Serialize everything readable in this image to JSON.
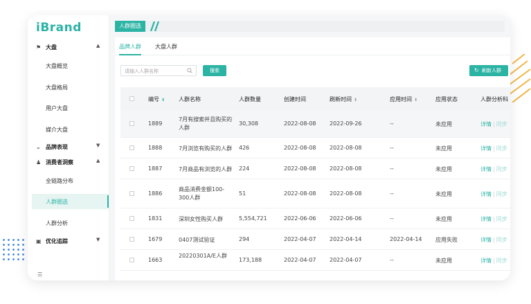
{
  "brand": {
    "logo": "iBrand",
    "accent": "#2bb3a4"
  },
  "sidebar": {
    "groups": [
      {
        "label": "大盘",
        "icon": "flag-icon",
        "caret": "▲"
      },
      {
        "label": "品牌表现",
        "icon": "chevron-icon",
        "caret": "▼"
      },
      {
        "label": "消费者洞察",
        "icon": "user-icon",
        "caret": "▲"
      },
      {
        "label": "优化追踪",
        "icon": "calendar-icon",
        "caret": "▼"
      }
    ],
    "items": [
      {
        "label": "大盘概览"
      },
      {
        "label": "大盘格局"
      },
      {
        "label": "用户大盘"
      },
      {
        "label": "媒介大盘"
      },
      {
        "label": "全链路分布"
      },
      {
        "label": "人群圈选"
      },
      {
        "label": "人群分析"
      }
    ],
    "active_item": "人群圈选"
  },
  "breadcrumb": {
    "current": "人群圈选"
  },
  "tabs": [
    {
      "label": "品牌人群"
    },
    {
      "label": "大盘人群"
    }
  ],
  "toolbar": {
    "search_placeholder": "请输入人群名称",
    "search_button": "搜索",
    "refresh_button": "刷新人群"
  },
  "table": {
    "columns": [
      "编号",
      "人群名称",
      "人群数量",
      "创建时间",
      "刷新时间",
      "应用时间",
      "应用状态",
      "人群分析科"
    ],
    "rows": [
      {
        "id": "1889",
        "name": "7月有搜索并且购买的人群",
        "count": "30,308",
        "created": "2022-08-08",
        "refreshed": "2022-09-26",
        "applied": "--",
        "status": "未应用"
      },
      {
        "id": "1888",
        "name": "7月浏览有购买的人群",
        "count": "426",
        "created": "2022-08-08",
        "refreshed": "2022-08-08",
        "applied": "--",
        "status": "未应用"
      },
      {
        "id": "1887",
        "name": "7月商品有浏览的人群",
        "count": "224",
        "created": "2022-08-08",
        "refreshed": "2022-08-08",
        "applied": "--",
        "status": "未应用"
      },
      {
        "id": "1886",
        "name": "商品消费金额100-300人群",
        "count": "51",
        "created": "2022-08-08",
        "refreshed": "2022-08-08",
        "applied": "--",
        "status": "未应用"
      },
      {
        "id": "1831",
        "name": "深圳女性购买人群",
        "count": "5,554,721",
        "created": "2022-06-06",
        "refreshed": "2022-06-06",
        "applied": "--",
        "status": "未应用"
      },
      {
        "id": "1679",
        "name": "0407测试验证",
        "count": "294",
        "created": "2022-04-07",
        "refreshed": "2022-04-14",
        "applied": "2022-04-14",
        "status": "应用失败"
      },
      {
        "id": "1663",
        "name": "20220301A/E人群",
        "count": "173,188",
        "created": "2022-04-07",
        "refreshed": "2022-04-07",
        "applied": "--",
        "status": "未应用"
      }
    ],
    "action_detail": "详情",
    "action_sync": "同步"
  }
}
